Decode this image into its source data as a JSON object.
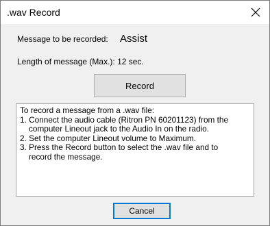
{
  "window": {
    "title": ".wav Record"
  },
  "icons": {
    "close": "close-icon"
  },
  "form": {
    "message_label": "Message to be recorded:",
    "message_value": "Assist",
    "length_label": "Length of message (Max.): 12 sec.",
    "record_label": "Record",
    "cancel_label": "Cancel"
  },
  "instructions": {
    "lines": [
      "To record a message from a .wav file:",
      "1. Connect the audio cable (Ritron PN 60201123) from the",
      "computer Lineout  jack to the Audio In on the radio.",
      "2. Set the computer Lineout volume to Maximum.",
      "3. Press the Record button to select the .wav file and to",
      "record the message."
    ]
  },
  "colors": {
    "focus_border": "#0078d7",
    "dialog_background": "#f0f0f0",
    "button_face": "#e1e1e1"
  }
}
